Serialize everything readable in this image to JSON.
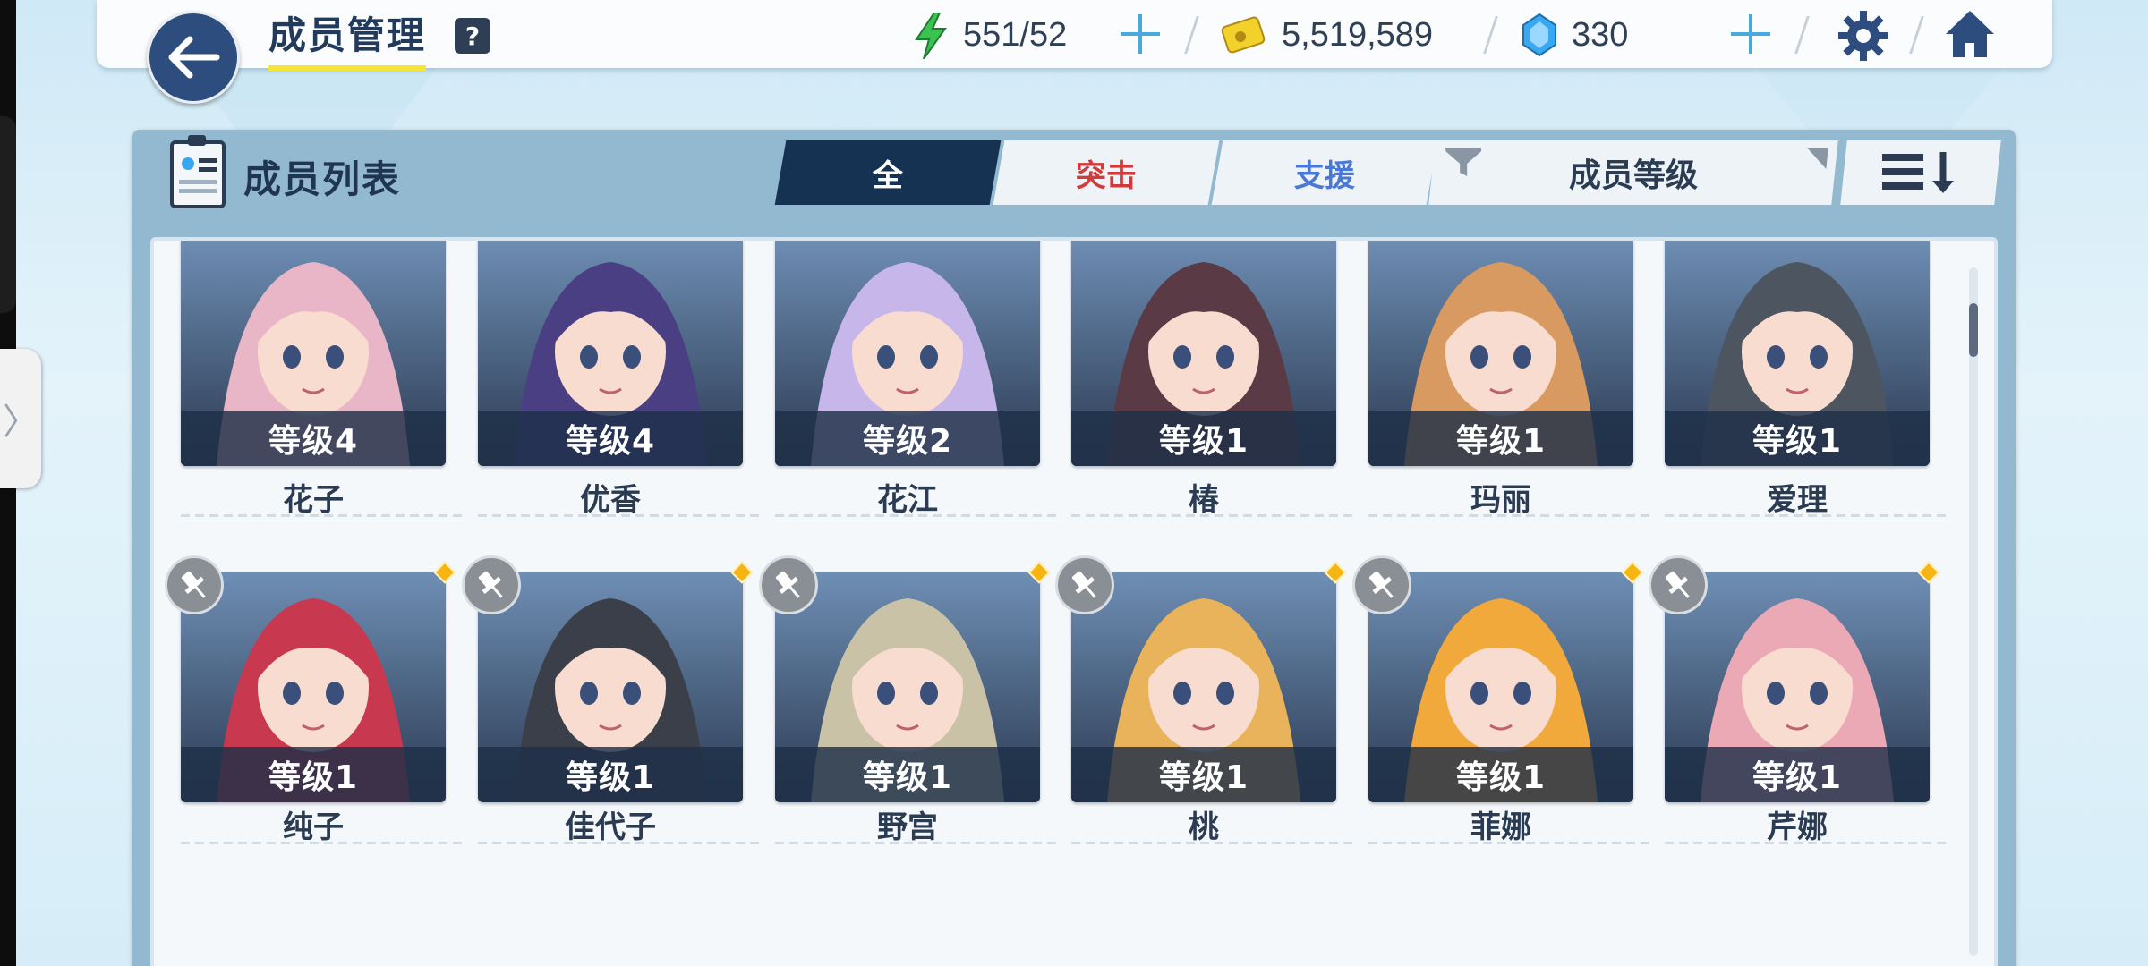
{
  "header": {
    "title": "成员管理",
    "help": "?",
    "ap": "551/52",
    "credits": "5,519,589",
    "gems": "330"
  },
  "panel": {
    "title": "成员列表",
    "tabs": [
      {
        "label": "全",
        "active": true
      },
      {
        "label": "突击",
        "active": false
      },
      {
        "label": "支援",
        "active": false
      }
    ],
    "filter_label": "成员等级"
  },
  "members_row1": [
    {
      "level": "等级4",
      "name": "花子",
      "bg": "#e9b6c8"
    },
    {
      "level": "等级4",
      "name": "优香",
      "bg": "#4b3f84"
    },
    {
      "level": "等级2",
      "name": "花江",
      "bg": "#c7b6ea"
    },
    {
      "level": "等级1",
      "name": "椿",
      "bg": "#5a3a44"
    },
    {
      "level": "等级1",
      "name": "玛丽",
      "bg": "#d99a62"
    },
    {
      "level": "等级1",
      "name": "爱理",
      "bg": "#4d5560"
    }
  ],
  "members_row2": [
    {
      "level": "等级1",
      "name": "纯子",
      "bg": "#c8384f"
    },
    {
      "level": "等级1",
      "name": "佳代子",
      "bg": "#3a3f4a"
    },
    {
      "level": "等级1",
      "name": "野宫",
      "bg": "#c9c2a6"
    },
    {
      "level": "等级1",
      "name": "桃",
      "bg": "#e8b35a"
    },
    {
      "level": "等级1",
      "name": "菲娜",
      "bg": "#f0a93a"
    },
    {
      "level": "等级1",
      "name": "芹娜",
      "bg": "#eaa9b5"
    }
  ],
  "colors": {
    "accent_dark": "#163252",
    "strike": "#d23b3b",
    "support": "#4a78d9",
    "title_underline": "#f3e53b",
    "ap_icon": "#3cc251",
    "credit_icon": "#f2d12b",
    "gem_icon": "#3aa8f0"
  }
}
